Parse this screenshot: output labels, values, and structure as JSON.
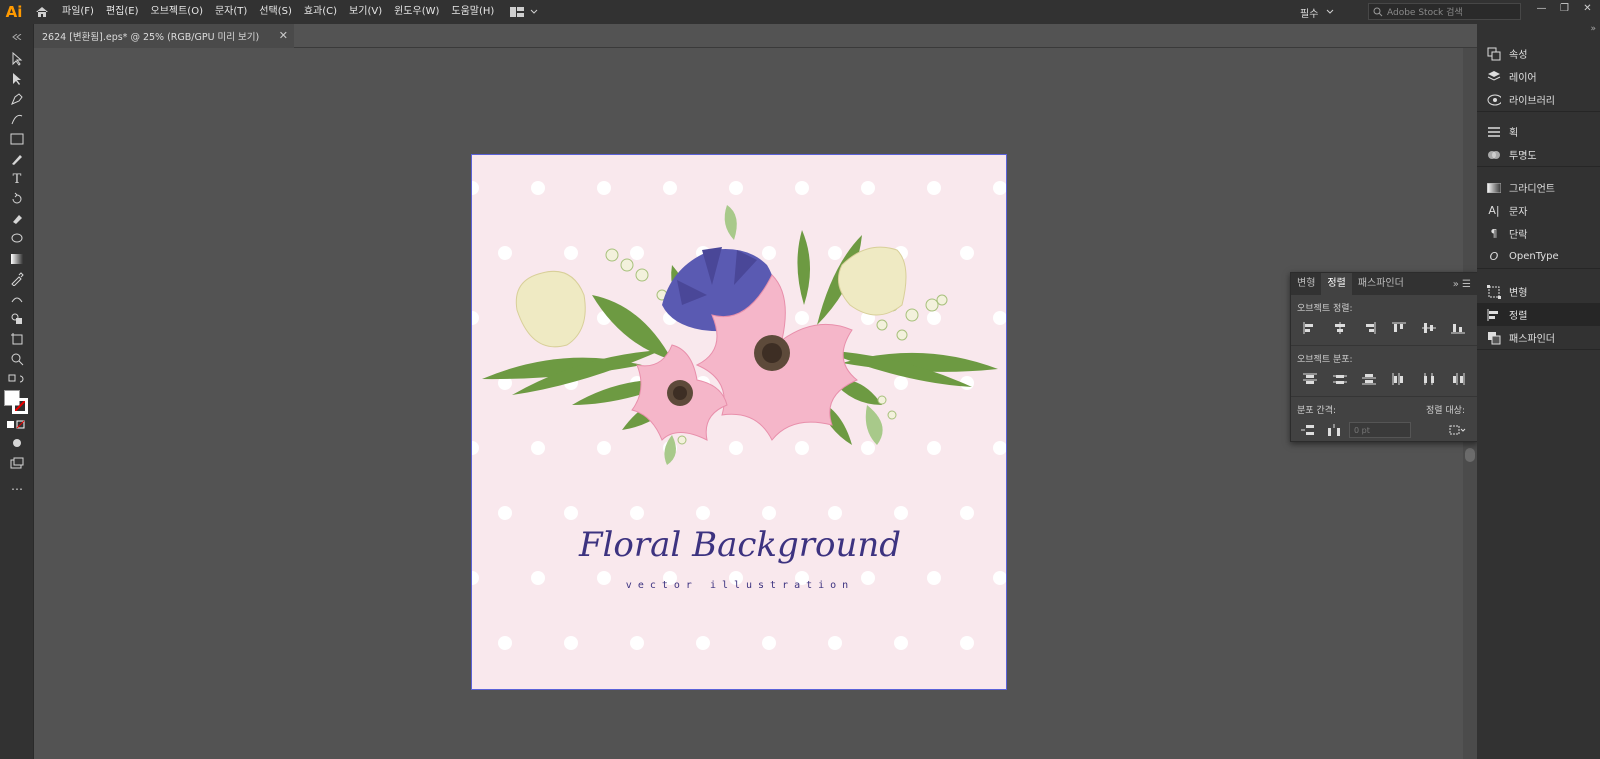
{
  "app": {
    "logo": "Ai"
  },
  "menu": [
    "파일(F)",
    "편집(E)",
    "오브젝트(O)",
    "문자(T)",
    "선택(S)",
    "효과(C)",
    "보기(V)",
    "윈도우(W)",
    "도움말(H)"
  ],
  "workspace": {
    "preset": "필수",
    "search_placeholder": "Adobe Stock 검색"
  },
  "document": {
    "tab_label": "2624 [변환됨].eps* @ 25% (RGB/GPU 미리 보기)"
  },
  "artwork": {
    "title": "Floral Background",
    "subtitle": "vector illustration",
    "background_color": "#f9e8ed",
    "dot_color": "#ffffff",
    "text_color": "#3d3380"
  },
  "right_dock": {
    "groups": [
      [
        "속성",
        "레이어",
        "라이브러리"
      ],
      [
        "획",
        "투명도"
      ],
      [
        "그라디언트",
        "문자",
        "단락",
        "OpenType"
      ],
      [
        "변형",
        "정렬",
        "패스파인더"
      ]
    ],
    "active": "정렬"
  },
  "align_panel": {
    "tabs": [
      "변형",
      "정렬",
      "패스파인더"
    ],
    "active_tab": "정렬",
    "object_align_label": "오브젝트 정렬:",
    "distribute_objects_label": "오브젝트 분포:",
    "distribute_spacing_label": "분포 간격:",
    "align_to_label": "정렬 대상:",
    "spacing_value": "0 pt"
  },
  "icons": {
    "home": "home-icon",
    "workspace": "workspace-switcher-icon",
    "search": "search-icon"
  },
  "colors": {
    "menubar": "#323232",
    "canvas": "#535353",
    "accent": "#ff9a00"
  }
}
